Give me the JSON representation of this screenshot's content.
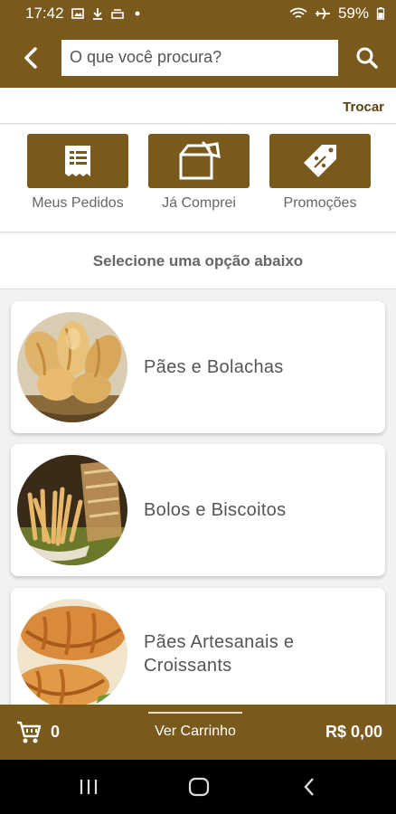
{
  "status_bar": {
    "time": "17:42",
    "battery": "59%",
    "icons": [
      "image-icon",
      "download-icon",
      "tray-icon",
      "dot-icon",
      "wifi-icon",
      "airplane-icon",
      "battery-icon"
    ]
  },
  "header": {
    "search_placeholder": "O que você procura?",
    "back_icon": "chevron-left-icon",
    "search_icon": "search-icon"
  },
  "trocar_label": "Trocar",
  "quick_actions": [
    {
      "label": "Meus Pedidos",
      "icon": "receipt-icon"
    },
    {
      "label": "Já Comprei",
      "icon": "box-icon"
    },
    {
      "label": "Promoções",
      "icon": "tag-icon"
    }
  ],
  "section_title": "Selecione uma opção abaixo",
  "categories": [
    {
      "label": "Pães e Bolachas"
    },
    {
      "label": "Bolos e Biscoitos"
    },
    {
      "label_line1": "Pães Artesanais e",
      "label_line2": "Croissants"
    }
  ],
  "cart": {
    "count": "0",
    "view_label": "Ver Carrinho",
    "total": "R$ 0,00"
  },
  "colors": {
    "brand": "#7a5a1c",
    "trocar_text": "#5a4215"
  }
}
